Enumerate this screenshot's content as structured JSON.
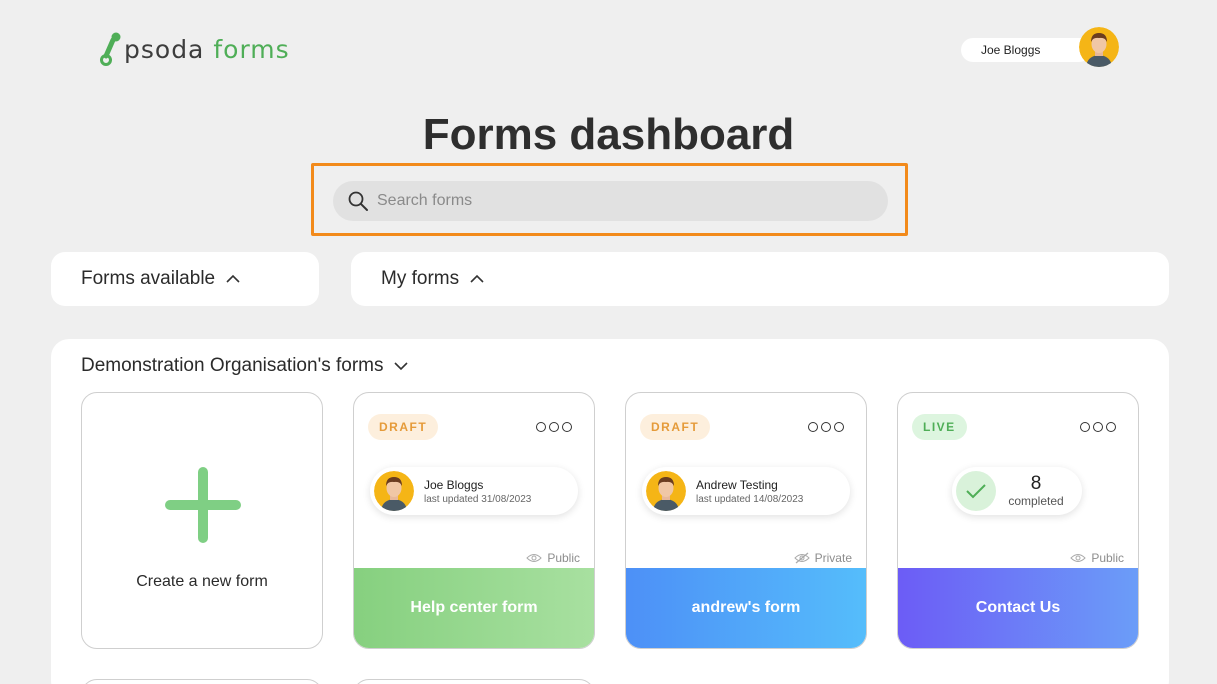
{
  "header": {
    "logo_part1": "psoda",
    "logo_part2": "forms",
    "user_name": "Joe Bloggs"
  },
  "page": {
    "title": "Forms dashboard"
  },
  "search": {
    "placeholder": "Search forms"
  },
  "tabs": [
    {
      "label": "Forms available"
    },
    {
      "label": "My forms"
    }
  ],
  "organisation": {
    "title": "Demonstration Organisation's forms"
  },
  "create_card": {
    "label": "Create a new form"
  },
  "cards": [
    {
      "status": "DRAFT",
      "owner": "Joe Bloggs",
      "updated": "last updated 31/08/2023",
      "visibility": "Public",
      "title": "Help center form",
      "footer_color_start": "#86d07f",
      "footer_color_end": "#a8e0a0"
    },
    {
      "status": "DRAFT",
      "owner": "Andrew Testing",
      "updated": "last updated 14/08/2023",
      "visibility": "Private",
      "title": "andrew's form",
      "footer_color_start": "#4d90f7",
      "footer_color_end": "#55bdfb"
    },
    {
      "status": "LIVE",
      "completed_count": "8",
      "completed_label": "completed",
      "visibility": "Public",
      "title": "Contact Us",
      "footer_color_start": "#6c5cf6",
      "footer_color_end": "#6b9df8"
    }
  ],
  "colors": {
    "accent_orange": "#f28a1b",
    "brand_green": "#4fae57"
  }
}
